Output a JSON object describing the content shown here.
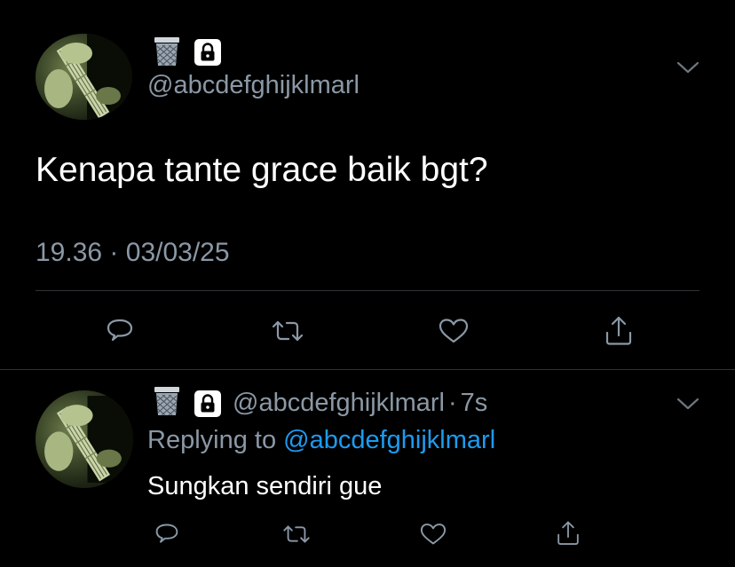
{
  "main_tweet": {
    "avatar_icon": "guitar-photo-avatar",
    "name_emoji": "wastebasket-emoji",
    "protected_icon": "lock-icon",
    "handle": "@abcdefghijklmarl",
    "text": "Kenapa tante grace baik bgt?",
    "time": "19.36",
    "separator": "·",
    "date": "03/03/25",
    "actions": [
      "reply-icon",
      "retweet-icon",
      "like-icon",
      "share-icon"
    ]
  },
  "reply_tweet": {
    "avatar_icon": "guitar-photo-avatar",
    "name_emoji": "wastebasket-emoji",
    "protected_icon": "lock-icon",
    "handle": "@abcdefghijklmarl",
    "separator": "·",
    "age": "7s",
    "replying_prefix": "Replying to",
    "replying_handle": "@abcdefghijklmarl",
    "text": "Sungkan sendiri gue",
    "actions": [
      "reply-icon",
      "retweet-icon",
      "like-icon",
      "share-icon"
    ]
  },
  "colors": {
    "background": "#000000",
    "text_primary": "#ffffff",
    "text_secondary": "#8b98a5",
    "accent": "#1d9bf0",
    "divider": "#2f3336"
  }
}
